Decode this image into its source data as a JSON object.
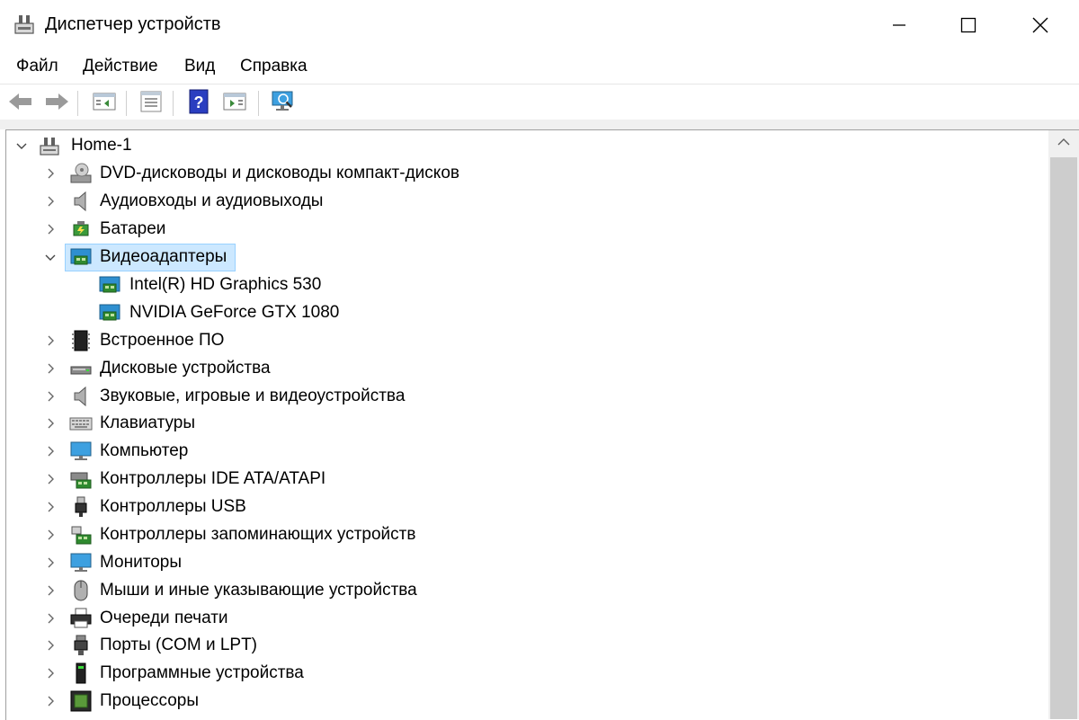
{
  "window": {
    "title": "Диспетчер устройств",
    "controls": [
      "minimize",
      "maximize",
      "close"
    ]
  },
  "menu": [
    {
      "label": "Файл"
    },
    {
      "label": "Действие"
    },
    {
      "label": "Вид"
    },
    {
      "label": "Справка"
    }
  ],
  "toolbar": {
    "buttons": [
      "back-arrow-icon",
      "forward-arrow-icon",
      "show-hide-console-tree-icon",
      "properties-icon",
      "help-icon",
      "action-pane-icon",
      "scan-hardware-icon"
    ]
  },
  "tree": {
    "root": {
      "label": "Home-1",
      "expanded": true
    },
    "categories": [
      {
        "label": "DVD-дисководы и дисководы компакт-дисков",
        "icon": "dvd-drive-icon",
        "expanded": false
      },
      {
        "label": "Аудиовходы и аудиовыходы",
        "icon": "speaker-icon",
        "expanded": false
      },
      {
        "label": "Батареи",
        "icon": "battery-icon",
        "expanded": false
      },
      {
        "label": "Видеоадаптеры",
        "icon": "display-adapter-icon",
        "expanded": true,
        "selected": true,
        "children": [
          {
            "label": "Intel(R) HD Graphics 530",
            "icon": "display-adapter-icon"
          },
          {
            "label": "NVIDIA GeForce GTX 1080",
            "icon": "display-adapter-icon"
          }
        ]
      },
      {
        "label": "Встроенное ПО",
        "icon": "firmware-chip-icon",
        "expanded": false
      },
      {
        "label": "Дисковые устройства",
        "icon": "disk-drive-icon",
        "expanded": false
      },
      {
        "label": "Звуковые, игровые и видеоустройства",
        "icon": "speaker-icon",
        "expanded": false
      },
      {
        "label": "Клавиатуры",
        "icon": "keyboard-icon",
        "expanded": false
      },
      {
        "label": "Компьютер",
        "icon": "computer-monitor-icon",
        "expanded": false
      },
      {
        "label": "Контроллеры IDE ATA/ATAPI",
        "icon": "ide-controller-icon",
        "expanded": false
      },
      {
        "label": "Контроллеры USB",
        "icon": "usb-plug-icon",
        "expanded": false
      },
      {
        "label": "Контроллеры запоминающих устройств",
        "icon": "storage-controller-icon",
        "expanded": false
      },
      {
        "label": "Мониторы",
        "icon": "monitor-icon",
        "expanded": false
      },
      {
        "label": "Мыши и иные указывающие устройства",
        "icon": "mouse-icon",
        "expanded": false
      },
      {
        "label": "Очереди печати",
        "icon": "printer-icon",
        "expanded": false
      },
      {
        "label": "Порты (COM и LPT)",
        "icon": "port-connector-icon",
        "expanded": false
      },
      {
        "label": "Программные устройства",
        "icon": "software-device-icon",
        "expanded": false
      },
      {
        "label": "Процессоры",
        "icon": "processor-icon",
        "expanded": false
      }
    ]
  },
  "colors": {
    "selection_bg": "#cce8ff",
    "selection_border": "#99d1ff",
    "scrollbar_track": "#f0f0f0",
    "scrollbar_thumb": "#cdcdcd"
  }
}
